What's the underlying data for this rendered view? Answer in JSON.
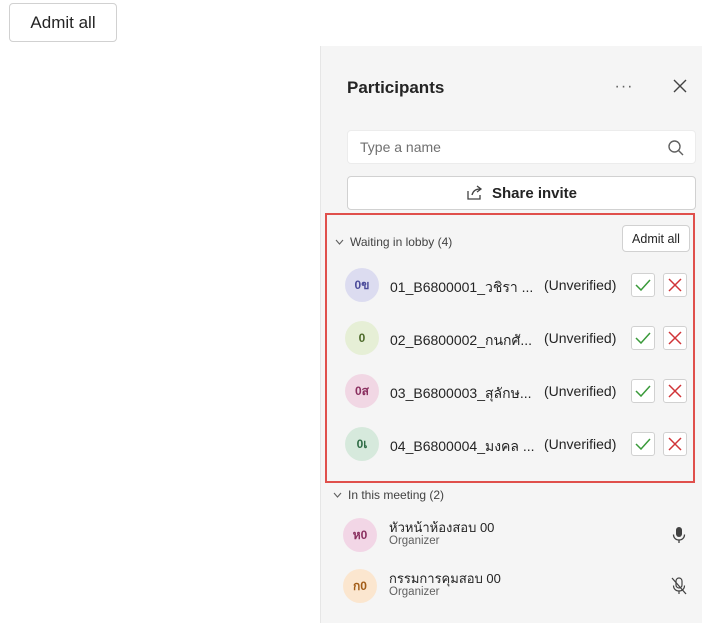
{
  "top_button": {
    "label": "Admit all"
  },
  "panel": {
    "title": "Participants",
    "more_label": "···",
    "search_placeholder": "Type a name",
    "share_label": "Share invite",
    "lobby": {
      "heading": "Waiting in lobby (4)",
      "admit_all_label": "Admit all",
      "people": [
        {
          "initials": "0ข",
          "name": "01_B6800001_วชิรา ...",
          "status": "(Unverified)",
          "avatar_bg": "#dcdcf0",
          "avatar_fg": "#4b4b9a"
        },
        {
          "initials": "0",
          "name": "02_B6800002_กนกศั...",
          "status": "(Unverified)",
          "avatar_bg": "#e6efd6",
          "avatar_fg": "#4d6a2a"
        },
        {
          "initials": "0ส",
          "name": "03_B6800003_สุลักษ...",
          "status": "(Unverified)",
          "avatar_bg": "#f1d7e4",
          "avatar_fg": "#8a2f5f"
        },
        {
          "initials": "0เ",
          "name": "04_B6800004_มงคล ...",
          "status": "(Unverified)",
          "avatar_bg": "#d6e9dc",
          "avatar_fg": "#2e6b45"
        }
      ]
    },
    "meeting": {
      "heading": "In this meeting (2)",
      "people": [
        {
          "initials": "ห0",
          "name": "หัวหน้าห้องสอบ 00",
          "role": "Organizer",
          "avatar_bg": "#f2d6e6",
          "avatar_fg": "#8a2f5f",
          "mic": "mic-on"
        },
        {
          "initials": "ก0",
          "name": "กรรมการคุมสอบ 00",
          "role": "Organizer",
          "avatar_bg": "#fbe6cf",
          "avatar_fg": "#a15b15",
          "mic": "mic-off"
        }
      ]
    }
  },
  "colors": {
    "highlight_border": "#e0504c",
    "accept": "#3a9a3a",
    "deny": "#d13438"
  }
}
